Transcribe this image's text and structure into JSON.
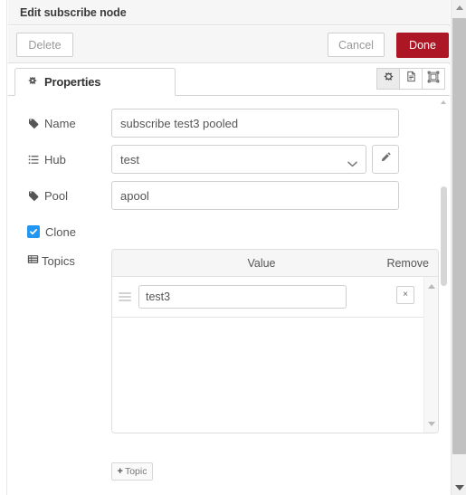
{
  "dialog": {
    "title": "Edit subscribe node",
    "buttons": {
      "delete": "Delete",
      "cancel": "Cancel",
      "done": "Done"
    },
    "accent_done_color": "#ad1625"
  },
  "tabs": [
    {
      "label": "Properties",
      "icon": "gear-icon",
      "active": true
    }
  ],
  "tool_buttons": [
    {
      "icon": "gear-icon",
      "active": true
    },
    {
      "icon": "description-icon",
      "active": false
    },
    {
      "icon": "appearance-icon",
      "active": false
    }
  ],
  "form": {
    "name": {
      "label": "Name",
      "icon": "tag-icon",
      "value": "subscribe test3 pooled",
      "placeholder": "Name"
    },
    "hub": {
      "label": "Hub",
      "icon": "list-icon",
      "value": "test",
      "options": [
        "test"
      ],
      "edit_icon": "pencil-icon"
    },
    "pool": {
      "label": "Pool",
      "icon": "tag-icon",
      "value": "apool",
      "placeholder": "Pool"
    },
    "clone": {
      "label": "Clone",
      "checked": true,
      "check_color": "#2196f3"
    },
    "topics": {
      "label": "Topics",
      "icon": "list-alt-icon",
      "columns": {
        "value": "Value",
        "remove": "Remove"
      },
      "rows": [
        {
          "value": "test3",
          "remove_label": "×"
        }
      ],
      "add_button": {
        "plus": "+",
        "label": "Topic"
      }
    }
  }
}
